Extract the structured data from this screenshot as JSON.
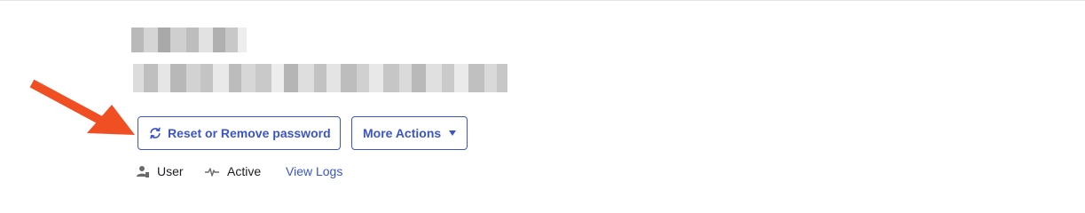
{
  "profile": {
    "name": "",
    "email": ""
  },
  "actions": {
    "reset_label": "Reset or Remove password",
    "reset_icon": "refresh-icon",
    "more_label": "More Actions",
    "more_icon": "caret-down-icon"
  },
  "meta": {
    "role_label": "User",
    "role_icon": "user-icon",
    "status_label": "Active",
    "status_icon": "pulse-icon",
    "logs_label": "View Logs"
  },
  "colors": {
    "accent": "#3c55c6",
    "annotation_arrow": "#f04e23",
    "text": "#1d1d21",
    "icon_gray": "#6b6b6b"
  }
}
